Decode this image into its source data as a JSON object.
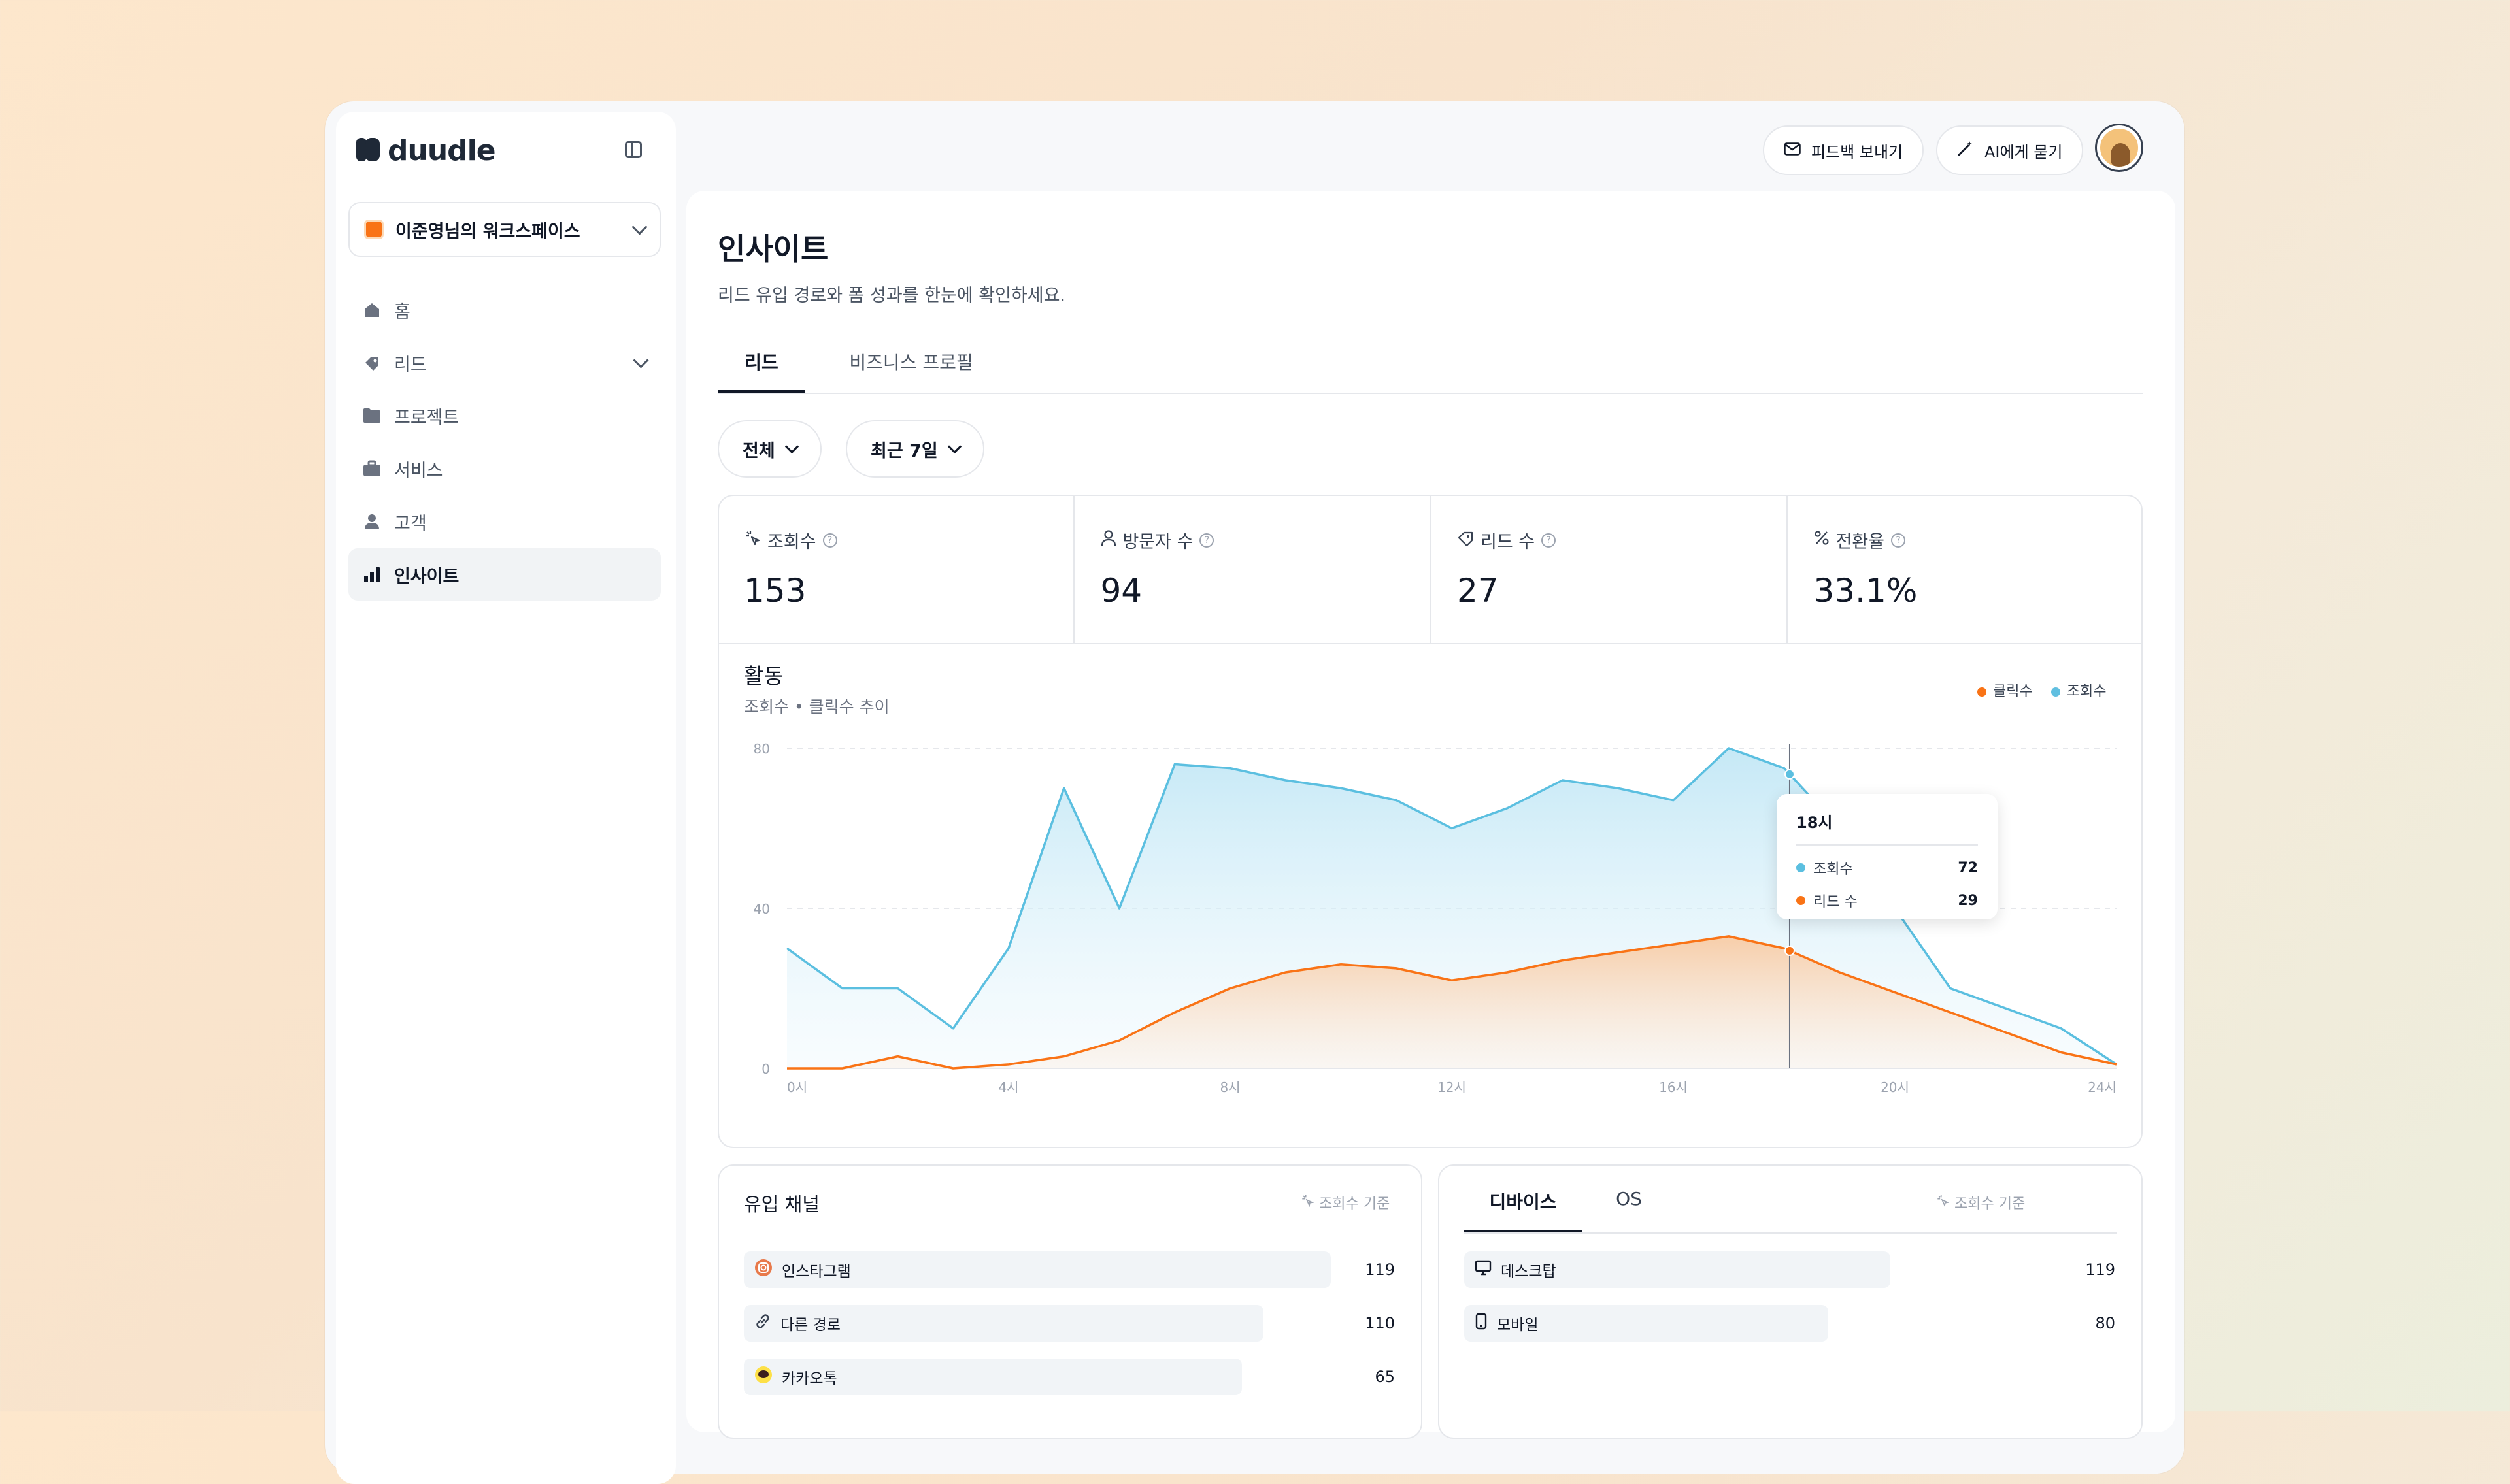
{
  "app": {
    "name": "duudle"
  },
  "workspace": {
    "name": "이준영님의 워크스페이스"
  },
  "sidebar": {
    "items": [
      {
        "label": "홈",
        "icon": "home-icon"
      },
      {
        "label": "리드",
        "icon": "lead-icon",
        "expandable": true
      },
      {
        "label": "프로젝트",
        "icon": "folder-icon"
      },
      {
        "label": "서비스",
        "icon": "briefcase-icon"
      },
      {
        "label": "고객",
        "icon": "user-icon"
      },
      {
        "label": "인사이트",
        "icon": "bar-chart-icon",
        "active": true
      }
    ]
  },
  "topbar": {
    "feedback_label": "피드백 보내기",
    "ai_label": "AI에게 묻기"
  },
  "page": {
    "title": "인사이트",
    "subtitle": "리드 유입 경로와 폼 성과를 한눈에 확인하세요."
  },
  "tabs": [
    {
      "label": "리드",
      "active": true
    },
    {
      "label": "비즈니스 프로필",
      "active": false
    }
  ],
  "filters": {
    "scope": "전체",
    "period": "최근 7일"
  },
  "stats": [
    {
      "label": "조회수",
      "value": "153",
      "icon": "sparkle-icon"
    },
    {
      "label": "방문자 수",
      "value": "94",
      "icon": "person-icon"
    },
    {
      "label": "리드 수",
      "value": "27",
      "icon": "lead-icon"
    },
    {
      "label": "전환율",
      "value": "33.1%",
      "icon": "percent-icon"
    }
  ],
  "activity": {
    "title": "활동",
    "subtitle": "조회수 • 클릭수 추이",
    "legend": [
      {
        "label": "클릭수",
        "color": "#f97316"
      },
      {
        "label": "조회수",
        "color": "#60bfe0"
      }
    ],
    "tooltip": {
      "title": "18시",
      "rows": [
        {
          "label": "조회수",
          "value": "72"
        },
        {
          "label": "리드 수",
          "value": "29"
        }
      ]
    }
  },
  "chart_data": {
    "type": "area",
    "x": [
      0,
      1,
      2,
      3,
      4,
      5,
      6,
      7,
      8,
      9,
      10,
      11,
      12,
      13,
      14,
      15,
      16,
      17,
      18,
      19,
      20,
      21,
      22,
      23,
      24
    ],
    "xticks": [
      "0시",
      "4시",
      "8시",
      "12시",
      "16시",
      "20시",
      "24시"
    ],
    "xtick_values": [
      0,
      4,
      8,
      12,
      16,
      20,
      24
    ],
    "yticks": [
      "0",
      "40",
      "80"
    ],
    "ytick_values": [
      0,
      40,
      80
    ],
    "ylim": [
      0,
      80
    ],
    "series": [
      {
        "name": "조회수",
        "color": "#5bbfe0",
        "values": [
          30,
          20,
          20,
          10,
          30,
          70,
          40,
          76,
          75,
          72,
          70,
          67,
          60,
          65,
          72,
          70,
          67,
          80,
          75,
          60,
          40,
          20,
          15,
          10,
          1
        ]
      },
      {
        "name": "클릭수",
        "color": "#f97316",
        "values": [
          0,
          0,
          3,
          0,
          1,
          3,
          7,
          14,
          20,
          24,
          26,
          25,
          22,
          24,
          27,
          29,
          31,
          33,
          30,
          24,
          19,
          14,
          9,
          4,
          1
        ]
      }
    ],
    "highlight_x": 18.1,
    "grid": true
  },
  "channels": {
    "title": "유입 채널",
    "basis": "조회수 기준",
    "items": [
      {
        "label": "인스타그램",
        "value": "119",
        "fraction": 1.0,
        "icon": "instagram-icon"
      },
      {
        "label": "다른 경로",
        "value": "110",
        "fraction": 0.885,
        "icon": "link-icon"
      },
      {
        "label": "카카오톡",
        "value": "65",
        "fraction": 0.84,
        "icon": "kakaotalk-icon"
      }
    ]
  },
  "devices": {
    "tabs": [
      {
        "label": "디바이스",
        "active": true
      },
      {
        "label": "OS",
        "active": false
      }
    ],
    "basis": "조회수 기준",
    "items": [
      {
        "label": "데스크탑",
        "value": "119",
        "fraction": 1.0,
        "icon": "monitor-icon"
      },
      {
        "label": "모바일",
        "value": "80",
        "fraction": 0.876,
        "icon": "mobile-icon"
      }
    ]
  }
}
